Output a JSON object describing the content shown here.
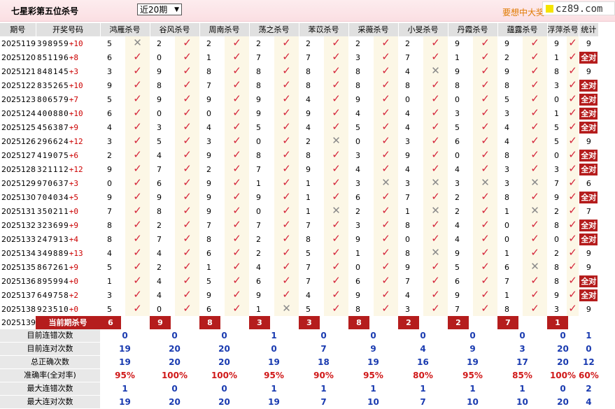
{
  "header": {
    "title": "七星彩第五位杀号",
    "period_select": "近20期",
    "promo_text": "要想中大奖",
    "logo_text": "cz89.com"
  },
  "columns": [
    "期号",
    "开奖号码",
    "鸿雁杀号",
    "谷风杀号",
    "周南杀号",
    "荡之杀号",
    "苯苡杀号",
    "采薇杀号",
    "小旻杀号",
    "丹霞杀号",
    "蕴露杀号",
    "浮萍杀号",
    "统计"
  ],
  "rows": [
    {
      "period": "2025119",
      "draw": "398959",
      "sum": "+10",
      "kills": [
        "5",
        "2",
        "2",
        "2",
        "2",
        "2",
        "2",
        "9",
        "9",
        "9"
      ],
      "ok": [
        0,
        1,
        1,
        1,
        1,
        1,
        1,
        1,
        1,
        1
      ],
      "stat": "9"
    },
    {
      "period": "2025120",
      "draw": "851196",
      "sum": "+8",
      "kills": [
        "6",
        "0",
        "1",
        "7",
        "7",
        "3",
        "7",
        "1",
        "2",
        "1"
      ],
      "ok": [
        1,
        1,
        1,
        1,
        1,
        1,
        1,
        1,
        1,
        1
      ],
      "stat": "全对"
    },
    {
      "period": "2025121",
      "draw": "848145",
      "sum": "+3",
      "kills": [
        "3",
        "9",
        "8",
        "8",
        "8",
        "8",
        "4",
        "9",
        "9",
        "8"
      ],
      "ok": [
        1,
        1,
        1,
        1,
        1,
        1,
        0,
        1,
        1,
        1
      ],
      "stat": "9"
    },
    {
      "period": "2025122",
      "draw": "835265",
      "sum": "+10",
      "kills": [
        "9",
        "8",
        "7",
        "8",
        "8",
        "8",
        "8",
        "8",
        "8",
        "3"
      ],
      "ok": [
        1,
        1,
        1,
        1,
        1,
        1,
        1,
        1,
        1,
        1
      ],
      "stat": "全对"
    },
    {
      "period": "2025123",
      "draw": "806579",
      "sum": "+7",
      "kills": [
        "5",
        "9",
        "9",
        "9",
        "4",
        "9",
        "0",
        "0",
        "5",
        "0"
      ],
      "ok": [
        1,
        1,
        1,
        1,
        1,
        1,
        1,
        1,
        1,
        1
      ],
      "stat": "全对"
    },
    {
      "period": "2025124",
      "draw": "400880",
      "sum": "+10",
      "kills": [
        "6",
        "0",
        "0",
        "9",
        "9",
        "4",
        "4",
        "3",
        "3",
        "1"
      ],
      "ok": [
        1,
        1,
        1,
        1,
        1,
        1,
        1,
        1,
        1,
        1
      ],
      "stat": "全对"
    },
    {
      "period": "2025125",
      "draw": "456387",
      "sum": "+9",
      "kills": [
        "4",
        "3",
        "4",
        "5",
        "4",
        "5",
        "4",
        "5",
        "4",
        "5"
      ],
      "ok": [
        1,
        1,
        1,
        1,
        1,
        1,
        1,
        1,
        1,
        1
      ],
      "stat": "全对"
    },
    {
      "period": "2025126",
      "draw": "296624",
      "sum": "+12",
      "kills": [
        "3",
        "5",
        "3",
        "0",
        "2",
        "0",
        "3",
        "6",
        "4",
        "5"
      ],
      "ok": [
        1,
        1,
        1,
        1,
        0,
        1,
        1,
        1,
        1,
        1
      ],
      "stat": "9"
    },
    {
      "period": "2025127",
      "draw": "419075",
      "sum": "+6",
      "kills": [
        "2",
        "4",
        "9",
        "8",
        "8",
        "3",
        "9",
        "0",
        "8",
        "0"
      ],
      "ok": [
        1,
        1,
        1,
        1,
        1,
        1,
        1,
        1,
        1,
        1
      ],
      "stat": "全对"
    },
    {
      "period": "2025128",
      "draw": "321112",
      "sum": "+12",
      "kills": [
        "9",
        "7",
        "2",
        "7",
        "9",
        "4",
        "4",
        "4",
        "3",
        "3"
      ],
      "ok": [
        1,
        1,
        1,
        1,
        1,
        1,
        1,
        1,
        1,
        1
      ],
      "stat": "全对"
    },
    {
      "period": "2025129",
      "draw": "970637",
      "sum": "+3",
      "kills": [
        "0",
        "6",
        "9",
        "1",
        "1",
        "3",
        "3",
        "3",
        "3",
        "7"
      ],
      "ok": [
        1,
        1,
        1,
        1,
        1,
        0,
        0,
        0,
        0,
        1
      ],
      "stat": "6"
    },
    {
      "period": "2025130",
      "draw": "704034",
      "sum": "+5",
      "kills": [
        "9",
        "9",
        "9",
        "9",
        "1",
        "6",
        "7",
        "2",
        "8",
        "9"
      ],
      "ok": [
        1,
        1,
        1,
        1,
        1,
        1,
        1,
        1,
        1,
        1
      ],
      "stat": "全对"
    },
    {
      "period": "2025131",
      "draw": "350211",
      "sum": "+0",
      "kills": [
        "7",
        "8",
        "9",
        "0",
        "1",
        "2",
        "1",
        "2",
        "1",
        "2"
      ],
      "ok": [
        1,
        1,
        1,
        1,
        0,
        1,
        0,
        1,
        0,
        1
      ],
      "stat": "7"
    },
    {
      "period": "2025132",
      "draw": "323699",
      "sum": "+9",
      "kills": [
        "8",
        "2",
        "7",
        "7",
        "7",
        "3",
        "8",
        "4",
        "0",
        "8"
      ],
      "ok": [
        1,
        1,
        1,
        1,
        1,
        1,
        1,
        1,
        1,
        1
      ],
      "stat": "全对"
    },
    {
      "period": "2025133",
      "draw": "247913",
      "sum": "+4",
      "kills": [
        "8",
        "7",
        "8",
        "2",
        "8",
        "9",
        "0",
        "4",
        "0",
        "0"
      ],
      "ok": [
        1,
        1,
        1,
        1,
        1,
        1,
        1,
        1,
        1,
        1
      ],
      "stat": "全对"
    },
    {
      "period": "2025134",
      "draw": "349889",
      "sum": "+13",
      "kills": [
        "4",
        "4",
        "6",
        "2",
        "5",
        "1",
        "8",
        "9",
        "1",
        "2"
      ],
      "ok": [
        1,
        1,
        1,
        1,
        1,
        1,
        0,
        1,
        1,
        1
      ],
      "stat": "9"
    },
    {
      "period": "2025135",
      "draw": "867261",
      "sum": "+9",
      "kills": [
        "5",
        "2",
        "1",
        "4",
        "7",
        "0",
        "9",
        "5",
        "6",
        "8"
      ],
      "ok": [
        1,
        1,
        1,
        1,
        1,
        1,
        1,
        1,
        0,
        1
      ],
      "stat": "9"
    },
    {
      "period": "2025136",
      "draw": "895994",
      "sum": "+0",
      "kills": [
        "1",
        "4",
        "5",
        "6",
        "7",
        "6",
        "7",
        "6",
        "7",
        "8"
      ],
      "ok": [
        1,
        1,
        1,
        1,
        1,
        1,
        1,
        1,
        1,
        1
      ],
      "stat": "全对"
    },
    {
      "period": "2025137",
      "draw": "649758",
      "sum": "+2",
      "kills": [
        "3",
        "4",
        "9",
        "9",
        "4",
        "9",
        "4",
        "9",
        "1",
        "9"
      ],
      "ok": [
        1,
        1,
        1,
        1,
        1,
        1,
        1,
        1,
        1,
        1
      ],
      "stat": "全对"
    },
    {
      "period": "2025138",
      "draw": "923510",
      "sum": "+0",
      "kills": [
        "5",
        "0",
        "6",
        "1",
        "5",
        "8",
        "3",
        "7",
        "8",
        "3"
      ],
      "ok": [
        1,
        1,
        1,
        0,
        1,
        1,
        1,
        1,
        1,
        1
      ],
      "stat": "9"
    }
  ],
  "current": {
    "period": "2025139",
    "label": "当前期杀号",
    "kills": [
      "6",
      "9",
      "8",
      "3",
      "3",
      "8",
      "2",
      "2",
      "7",
      "1"
    ]
  },
  "summary": [
    {
      "label": "目前连错次数",
      "values": [
        "0",
        "0",
        "0",
        "1",
        "0",
        "0",
        "0",
        "0",
        "0",
        "0",
        "1"
      ]
    },
    {
      "label": "目前连对次数",
      "values": [
        "19",
        "20",
        "20",
        "0",
        "7",
        "9",
        "4",
        "9",
        "3",
        "20",
        "0"
      ]
    },
    {
      "label": "总正确次数",
      "values": [
        "19",
        "20",
        "20",
        "19",
        "18",
        "19",
        "16",
        "19",
        "17",
        "20",
        "12"
      ]
    },
    {
      "label": "准确率(全对率)",
      "values": [
        "95%",
        "100%",
        "100%",
        "95%",
        "90%",
        "95%",
        "80%",
        "95%",
        "85%",
        "100%",
        "60%"
      ]
    },
    {
      "label": "最大连错次数",
      "values": [
        "1",
        "0",
        "0",
        "1",
        "1",
        "1",
        "1",
        "1",
        "1",
        "0",
        "2"
      ]
    },
    {
      "label": "最大连对次数",
      "values": [
        "19",
        "20",
        "20",
        "19",
        "7",
        "10",
        "7",
        "10",
        "10",
        "20",
        "4"
      ]
    }
  ],
  "icons": {
    "correct": "check-mark-icon",
    "wrong": "x-mark-icon"
  },
  "colors": {
    "accent": "#b51d1d",
    "correct": "#d4253a",
    "wrong": "#8a8a8a",
    "summary_blue": "#1a3bb0"
  }
}
